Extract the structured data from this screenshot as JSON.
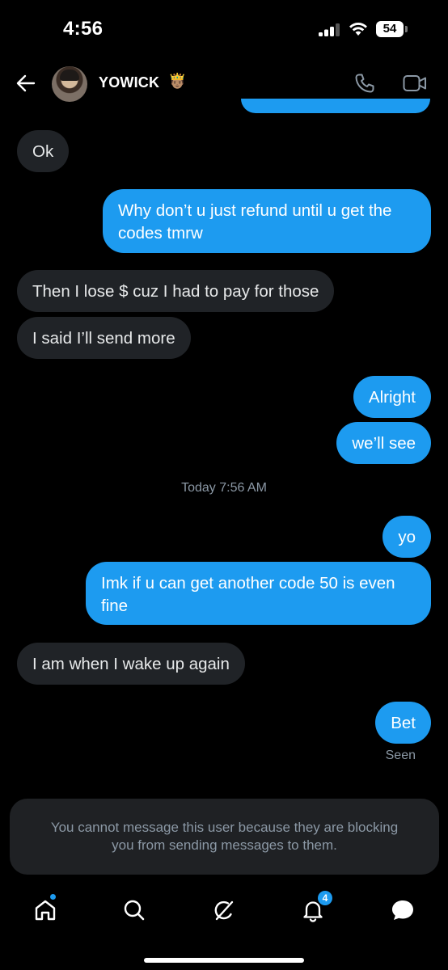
{
  "status_bar": {
    "time": "4:56",
    "battery": "54"
  },
  "header": {
    "name": "YOWICK",
    "emoji": "🤴🏽"
  },
  "messages": [
    {
      "dir": "in",
      "text": "Ok"
    },
    {
      "dir": "out",
      "text": "Why don’t u just refund until u get the codes tmrw"
    },
    {
      "dir": "in",
      "text": "Then I lose $ cuz I had to pay for those"
    },
    {
      "dir": "in",
      "text": "I said I’ll send more"
    },
    {
      "dir": "out",
      "text": "Alright"
    },
    {
      "dir": "out",
      "text": "we’ll see"
    },
    {
      "dir": "out",
      "text": "yo"
    },
    {
      "dir": "out",
      "text": "Imk if u can get another code 50 is even fine"
    },
    {
      "dir": "in",
      "text": "I am when I wake up again"
    },
    {
      "dir": "out",
      "text": "Bet"
    }
  ],
  "timestamp": "Today 7:56 AM",
  "seen_label": "Seen",
  "blocked_notice": "You cannot message this user because they are blocking you from sending messages to them.",
  "tab_bar": {
    "notifications_badge": "4"
  },
  "colors": {
    "accent": "#1d9bf0",
    "incoming_bubble": "#202327",
    "background": "#000000"
  }
}
